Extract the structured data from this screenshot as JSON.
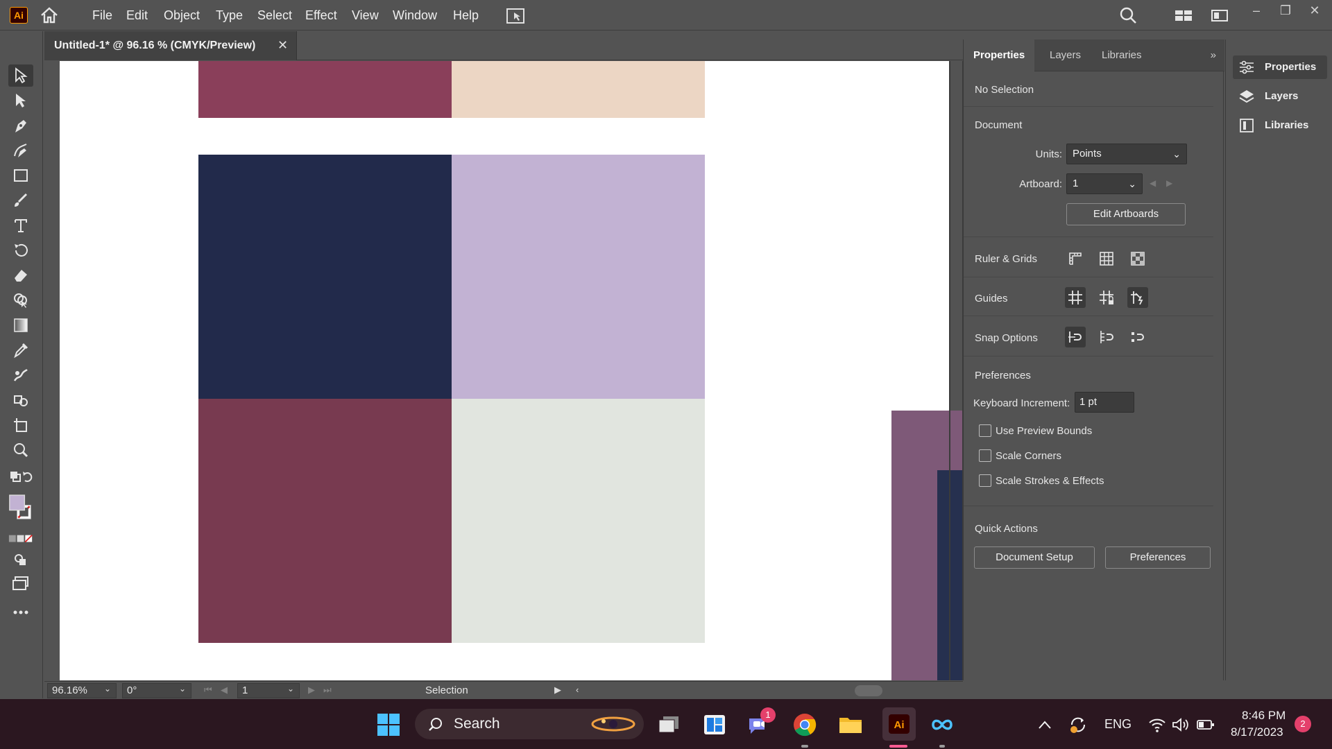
{
  "app": {
    "logo_text": "Ai",
    "menu": [
      "File",
      "Edit",
      "Object",
      "Type",
      "Select",
      "Effect",
      "View",
      "Window",
      "Help"
    ]
  },
  "document": {
    "tab_title": "Untitled-1* @ 96.16 % (CMYK/Preview)",
    "close_glyph": "✕"
  },
  "canvas": {
    "swatch_colors": [
      "#8a3f5a",
      "#ecd6c4",
      "#222a4b",
      "#c2b2d3",
      "#783a50",
      "#e1e5df",
      "#7e5978",
      "#26304f"
    ]
  },
  "statusbar": {
    "zoom": "96.16%",
    "rotation": "0°",
    "artboard": "1",
    "mode": "Selection"
  },
  "properties": {
    "tabs": [
      "Properties",
      "Layers",
      "Libraries"
    ],
    "selection_state": "No Selection",
    "document_heading": "Document",
    "units_label": "Units:",
    "units_value": "Points",
    "artboard_label": "Artboard:",
    "artboard_value": "1",
    "edit_artboards": "Edit Artboards",
    "ruler_grids": "Ruler & Grids",
    "guides": "Guides",
    "snap_options": "Snap Options",
    "preferences_heading": "Preferences",
    "keyboard_increment_label": "Keyboard Increment:",
    "keyboard_increment_value": "1 pt",
    "checkboxes": [
      "Use Preview Bounds",
      "Scale Corners",
      "Scale Strokes & Effects"
    ],
    "quick_actions": "Quick Actions",
    "document_setup": "Document Setup",
    "preferences_button": "Preferences"
  },
  "dock": {
    "items": [
      "Properties",
      "Layers",
      "Libraries"
    ]
  },
  "taskbar": {
    "search_label": "Search",
    "language": "ENG",
    "time": "8:46 PM",
    "date": "8/17/2023",
    "notifications": "2",
    "teams_badge": "1"
  }
}
